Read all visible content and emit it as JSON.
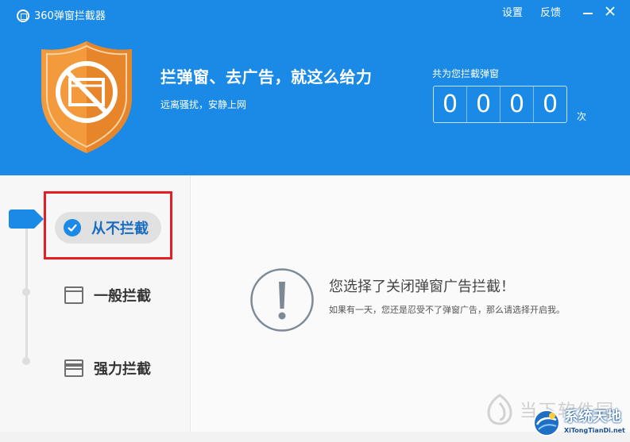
{
  "window": {
    "title": "360弹窗拦截器",
    "settings_label": "设置",
    "feedback_label": "反馈"
  },
  "header": {
    "slogan": "拦弹窗、去广告，就这么给力",
    "sub_slogan": "远离骚扰，安静上网",
    "counter_label": "共为您拦截弹窗",
    "counter_digits": [
      "0",
      "0",
      "0",
      "0"
    ],
    "counter_unit": "次",
    "brand_color": "#1a8ae6",
    "shield_color": "#f39a3c"
  },
  "modes": {
    "selected": "never",
    "items": [
      {
        "id": "never",
        "label": "从不拦截"
      },
      {
        "id": "normal",
        "label": "一般拦截"
      },
      {
        "id": "strong",
        "label": "强力拦截"
      }
    ],
    "highlight_color": "#e51e25"
  },
  "main": {
    "message_title": "您选择了关闭弹窗广告拦截！",
    "message_desc": "如果有一天，您还是忍受不了弹窗广告，那么请选择开启我。"
  },
  "watermark": {
    "gray_text": "当下软件园",
    "brand_cn": "系统天地",
    "brand_en": "XiTongTianDi.net"
  }
}
